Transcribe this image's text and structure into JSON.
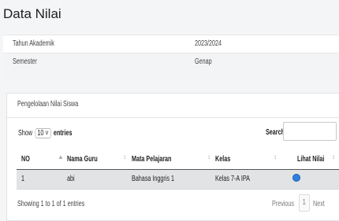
{
  "page": {
    "title": "Data Nilai"
  },
  "info": {
    "rows": [
      {
        "label": "Tahun Akademik",
        "value": "2023/2024"
      },
      {
        "label": "Semester",
        "value": "Genap"
      }
    ]
  },
  "card": {
    "title": "Pengelolaan Nilai Siswa"
  },
  "controls": {
    "show_label": "Show",
    "page_length": "10",
    "entries_label": "entries",
    "search_label": "Search:",
    "search_value": ""
  },
  "table": {
    "columns": [
      "NO",
      "Nama Guru",
      "Mata Pelajaran",
      "Kelas",
      "Lihat Nilai"
    ],
    "rows": [
      {
        "no": "1",
        "nama_guru": "abi",
        "mata_pelajaran": "Bahasa Inggris 1",
        "kelas": "Kelas 7-A IPA",
        "lihat_icon": "eye-icon"
      }
    ]
  },
  "footer": {
    "info": "Showing 1 to 1 of 1 entries",
    "previous": "Previous",
    "page": "1",
    "next": "Next"
  },
  "colors": {
    "accent": "#2f7fe0",
    "row_highlight": "#e2e3e5"
  }
}
